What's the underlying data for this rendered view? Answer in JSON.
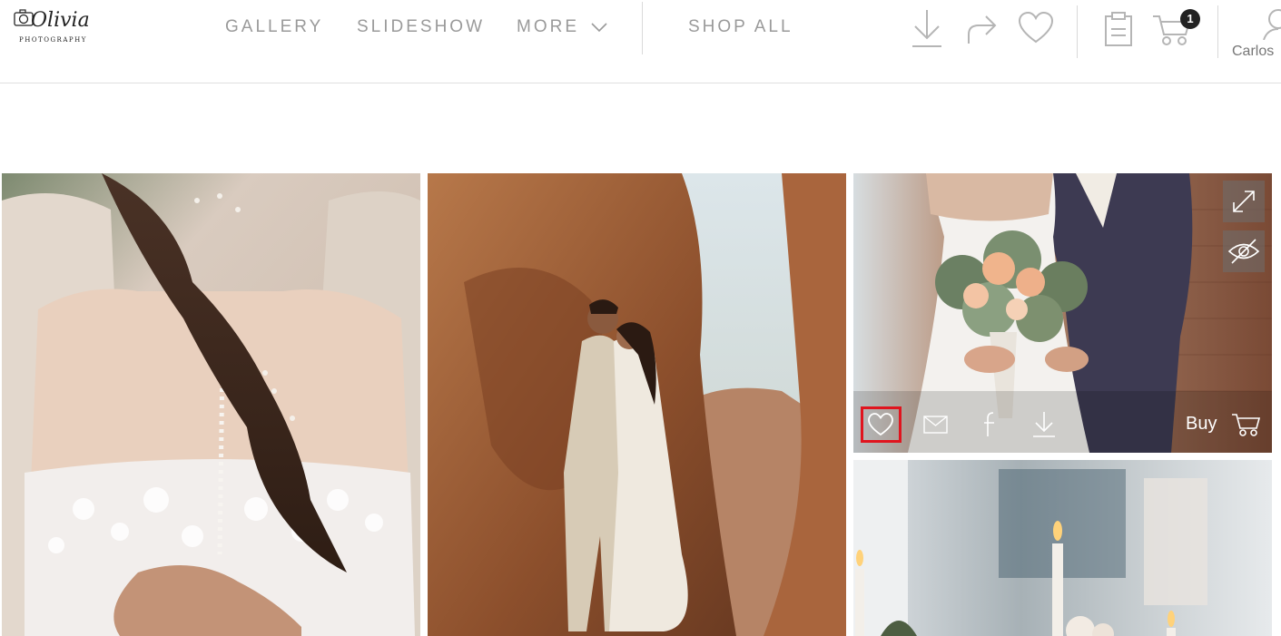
{
  "logo": {
    "brand": "Olivia",
    "subtitle": "PHOTOGRAPHY"
  },
  "nav": {
    "gallery": "GALLERY",
    "slideshow": "SLIDESHOW",
    "more": "MORE",
    "shop_all": "SHOP ALL"
  },
  "header_icons": [
    "download-icon",
    "share-icon",
    "heart-icon",
    "clipboard-icon",
    "cart-icon",
    "user-icon"
  ],
  "cart": {
    "count": "1"
  },
  "user": {
    "name": "Carlos"
  },
  "photo_actions": {
    "buy_label": "Buy",
    "icons": [
      "heart-icon",
      "mail-icon",
      "facebook-icon",
      "download-icon",
      "cart-icon"
    ],
    "overlay_icons": [
      "expand-icon",
      "hide-icon"
    ]
  },
  "photos": [
    {
      "subject": "bride-back-lace-dress"
    },
    {
      "subject": "couple-canyon-rocks"
    },
    {
      "subject": "bride-bouquet-groom"
    },
    {
      "subject": "candles-reception"
    }
  ],
  "colors": {
    "highlight": "#e0141e",
    "nav_text": "#9a9a9a",
    "badge": "#222222"
  }
}
